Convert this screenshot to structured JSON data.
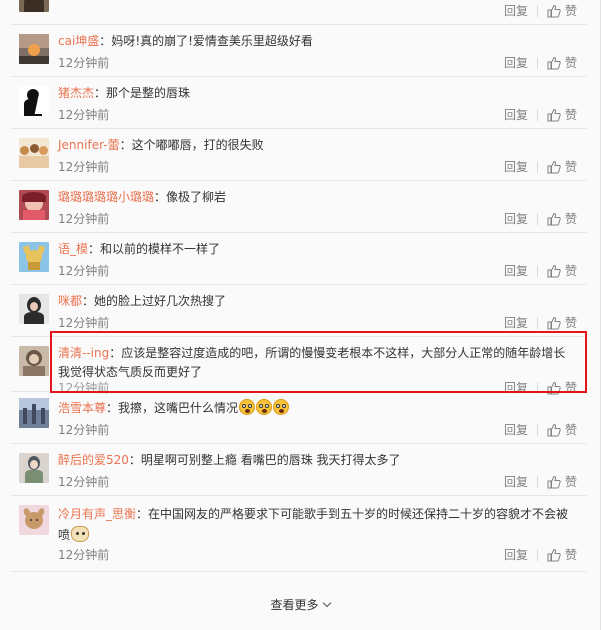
{
  "comments": [
    {
      "user": "",
      "text": "",
      "time": "",
      "reply": "回复",
      "like": "赞",
      "avatar": {
        "bg": "#7a6a55",
        "fg": "#3b2f25"
      }
    },
    {
      "user": "cai坤盛",
      "text": "妈呀!真的崩了!爱情查美乐里超级好看",
      "time": "12分钟前",
      "reply": "回复",
      "like": "赞",
      "avatar": {
        "bg": "#7d6f66",
        "fg": "#f0a04a"
      }
    },
    {
      "user": "猪杰杰",
      "text": "那个是整的唇珠",
      "time": "12分钟前",
      "reply": "回复",
      "like": "赞",
      "avatar": {
        "bg": "#ffffff",
        "fg": "#111111"
      }
    },
    {
      "user": "Jennifer-蕾",
      "text": "这个嘟嘟唇，打的很失败",
      "time": "12分钟前",
      "reply": "回复",
      "like": "赞",
      "avatar": {
        "bg": "#f3e7d4",
        "fg": "#c58b4a"
      }
    },
    {
      "user": "璐璐璐璐璐小璐璐",
      "text": "像极了柳岩",
      "time": "12分钟前",
      "reply": "回复",
      "like": "赞",
      "avatar": {
        "bg": "#b14a52",
        "fg": "#f0c0b0"
      }
    },
    {
      "user": "语_模",
      "text": "和以前的模样不一样了",
      "time": "12分钟前",
      "reply": "回复",
      "like": "赞",
      "avatar": {
        "bg": "#8cc4e8",
        "fg": "#e8c25a"
      }
    },
    {
      "user": "咪都",
      "text": "她的脸上过好几次热搜了",
      "time": "12分钟前",
      "reply": "回复",
      "like": "赞",
      "avatar": {
        "bg": "#e6e6e6",
        "fg": "#2b2b2b"
      }
    },
    {
      "user": "清清--ing",
      "text": "应该是整容过度造成的吧，所谓的慢慢变老根本不这样，大部分人正常的随年龄增长我觉得状态气质反而更好了",
      "time": "12分钟前",
      "reply": "回复",
      "like": "赞",
      "avatar": {
        "bg": "#c9b9a8",
        "fg": "#6a5646"
      }
    },
    {
      "user": "浩雪本尊",
      "text": "我擦，这嘴巴什么情况",
      "time": "12分钟前",
      "reply": "回复",
      "like": "赞",
      "avatar": {
        "bg": "#6f7f98",
        "fg": "#b8c7dd"
      }
    },
    {
      "user": "醉后的爱520",
      "text": "明星啊可别整上瘾 看嘴巴的唇珠 我天打得太多了",
      "time": "12分钟前",
      "reply": "回复",
      "like": "赞",
      "avatar": {
        "bg": "#d9d4cf",
        "fg": "#4d5860"
      }
    },
    {
      "user": "冷月有声_思衡",
      "text": "在中国网友的严格要求下可能歌手到五十岁的时候还保持二十岁的容貌才不会被喷",
      "time": "12分钟前",
      "reply": "回复",
      "like": "赞",
      "avatar": {
        "bg": "#f1d7de",
        "fg": "#c79a6a"
      }
    }
  ],
  "load_more": "查看更多",
  "colors": {
    "username": "#eb7350",
    "highlight": "#e4141d"
  }
}
